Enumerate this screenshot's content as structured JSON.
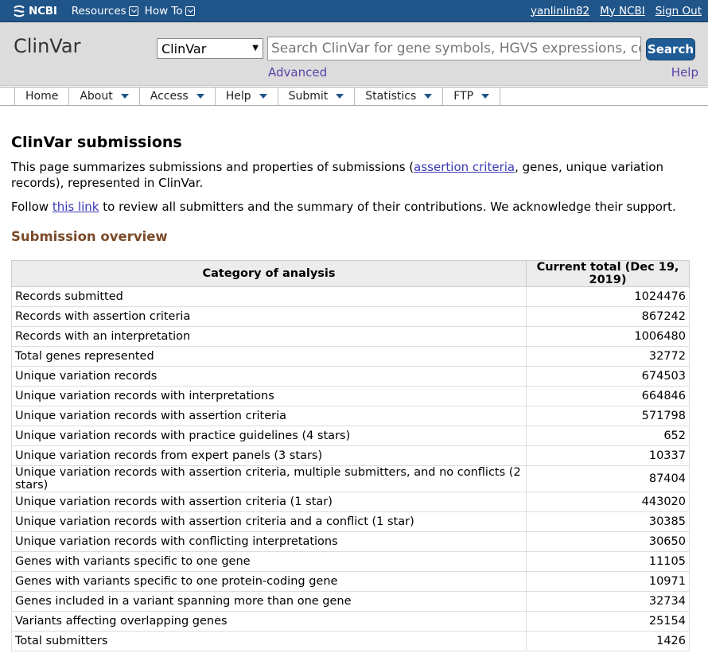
{
  "topbar": {
    "logo_text": "NCBI",
    "menu": [
      {
        "label": "Resources"
      },
      {
        "label": "How To"
      }
    ],
    "user": "yanlinlin82",
    "my_ncbi": "My NCBI",
    "sign_out": "Sign Out"
  },
  "header": {
    "db_title": "ClinVar",
    "db_select_value": "ClinVar",
    "search_placeholder": "Search ClinVar for gene symbols, HGVS expressions, conc",
    "search_button": "Search",
    "advanced": "Advanced",
    "help": "Help"
  },
  "nav": [
    "Home",
    "About",
    "Access",
    "Help",
    "Submit",
    "Statistics",
    "FTP"
  ],
  "main": {
    "title": "ClinVar submissions",
    "intro_before": "This page summarizes submissions and properties of submissions (",
    "intro_link": "assertion criteria",
    "intro_after": ", genes, unique variation records), represented in ClinVar.",
    "follow_before": "Follow ",
    "follow_link": "this link",
    "follow_after": " to review all submitters and the summary of their contributions. We acknowledge their support.",
    "section_title": "Submission overview",
    "table": {
      "headers": [
        "Category of analysis",
        "Current total (Dec 19, 2019)"
      ],
      "rows": [
        [
          "Records submitted",
          "1024476"
        ],
        [
          "Records with assertion criteria",
          "867242"
        ],
        [
          "Records with an interpretation",
          "1006480"
        ],
        [
          "Total genes represented",
          "32772"
        ],
        [
          "Unique variation records",
          "674503"
        ],
        [
          "Unique variation records with interpretations",
          "664846"
        ],
        [
          "Unique variation records with assertion criteria",
          "571798"
        ],
        [
          "Unique variation records with practice guidelines (4 stars)",
          "652"
        ],
        [
          "Unique variation records from expert panels (3 stars)",
          "10337"
        ],
        [
          "Unique variation records with assertion criteria, multiple submitters, and no conflicts (2 stars)",
          "87404"
        ],
        [
          "Unique variation records with assertion criteria (1 star)",
          "443020"
        ],
        [
          "Unique variation records with assertion criteria and a conflict (1 star)",
          "30385"
        ],
        [
          "Unique variation records with conflicting interpretations",
          "30650"
        ],
        [
          "Genes with variants specific to one gene",
          "11105"
        ],
        [
          "Genes with variants specific to one protein-coding gene",
          "10971"
        ],
        [
          "Genes included in a variant spanning more than one gene",
          "32734"
        ],
        [
          "Variants affecting overlapping genes",
          "25154"
        ],
        [
          "Total submitters",
          "1426"
        ]
      ]
    }
  },
  "colors": {
    "topbar": "#20558a",
    "header_bg": "#dcdcdc",
    "section_title": "#7a4a2a",
    "link": "#3b3bb3"
  }
}
